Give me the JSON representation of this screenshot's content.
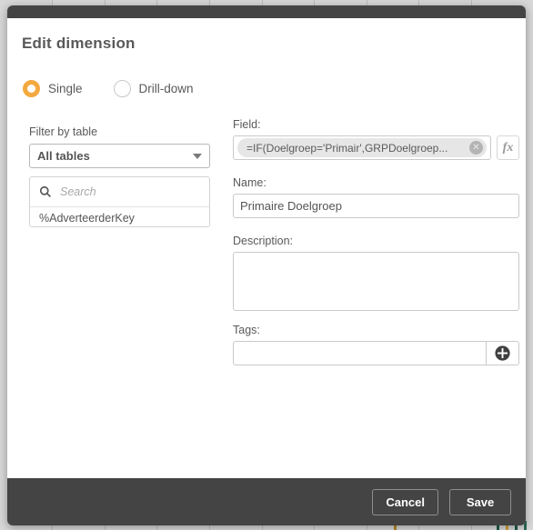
{
  "dialog": {
    "title": "Edit dimension",
    "mode_options": [
      {
        "label": "Single",
        "selected": true
      },
      {
        "label": "Drill-down",
        "selected": false
      }
    ],
    "left_panel": {
      "filter_label": "Filter by table",
      "table_select_value": "All tables",
      "search_placeholder": "Search",
      "field_list": [
        "%AdverteerderKey"
      ]
    },
    "right_panel": {
      "field_label": "Field:",
      "field_chip_text": "=IF(Doelgroep='Primair',GRPDoelgroep...",
      "fx_label": "fx",
      "clear_label": "✕",
      "name_label": "Name:",
      "name_value": "Primaire Doelgroep",
      "description_label": "Description:",
      "description_value": "",
      "tags_label": "Tags:",
      "tags_value": "",
      "tags_add_label": "+"
    },
    "footer": {
      "cancel_label": "Cancel",
      "save_label": "Save"
    },
    "colors": {
      "accent_orange": "#f4a93f",
      "chrome_dark": "#444444",
      "text_gray": "#595959"
    }
  }
}
